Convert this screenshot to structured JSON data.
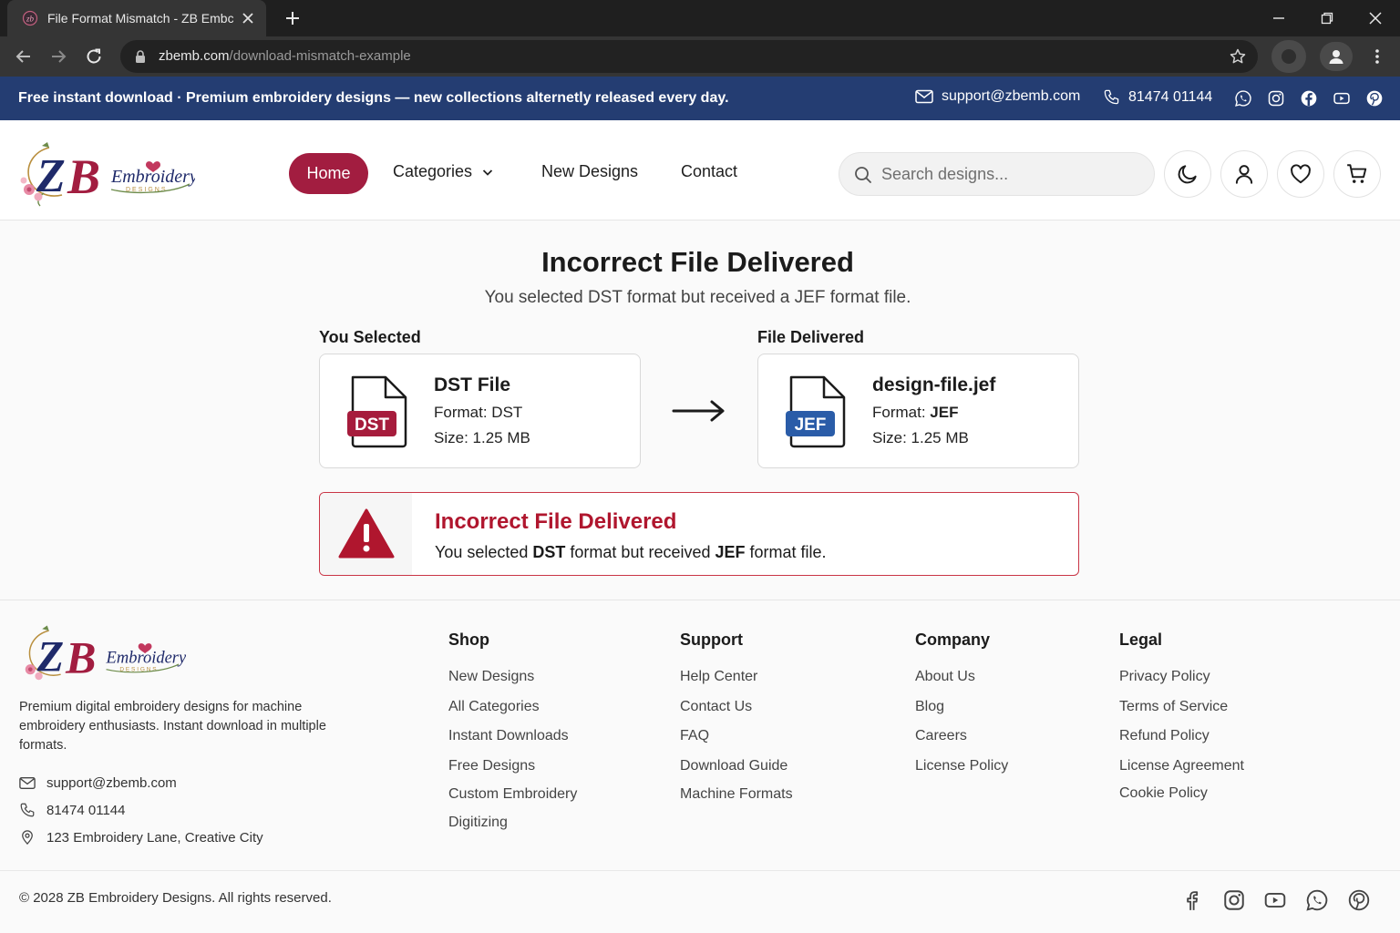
{
  "browser": {
    "tab_title": "File Format Mismatch - ZB Embc",
    "url_host": "zbemb.com",
    "url_path": "/download-mismatch-example"
  },
  "announcement": {
    "message": "Free instant download · Premium embroidery designs — new collections alternetly released every day.",
    "email": "support@zbemb.com",
    "phone": "81474 01144",
    "social_icons": [
      "whatsapp-icon",
      "instagram-icon",
      "facebook-icon",
      "youtube-icon",
      "pinterest-icon"
    ]
  },
  "header": {
    "nav": {
      "home": "Home",
      "categories": "Categories",
      "new_designs": "New Designs",
      "contact": "Contact"
    },
    "search_placeholder": "Search designs...",
    "icons": [
      "moon-icon",
      "user-icon",
      "heart-icon",
      "cart-icon"
    ]
  },
  "main": {
    "title": "Incorrect File Delivered",
    "subtitle": "You selected DST format but received a JEF format file.",
    "selected": {
      "label": "You Selected",
      "badge": "DST",
      "name": "DST File",
      "format_label": "Format: ",
      "format": "DST",
      "size": "Size: 1.25 MB"
    },
    "delivered": {
      "label": "File Delivered",
      "badge": "JEF",
      "name": "design-file.jef",
      "format_label": "Format: ",
      "format": "JEF",
      "size": "Size: 1.25 MB"
    },
    "error": {
      "title": "Incorrect File Delivered",
      "text_1": "You selected ",
      "format_1": "DST",
      "text_2": " format but received ",
      "format_2": "JEF",
      "text_3": " format file."
    }
  },
  "footer": {
    "description": "Premium digital embroidery designs for machine embroidery enthusiasts. Instant download in multiple formats.",
    "email": "support@zbemb.com",
    "phone": "81474 01144",
    "address": "123 Embroidery Lane, Creative City",
    "columns": [
      {
        "title": "Shop",
        "links": [
          "New Designs",
          "All Categories",
          "Instant Downloads",
          "Free Designs",
          "Custom Embroidery",
          "Digitizing"
        ]
      },
      {
        "title": "Support",
        "links": [
          "Help Center",
          "Contact Us",
          "FAQ",
          "Download Guide",
          "Machine Formats"
        ]
      },
      {
        "title": "Company",
        "links": [
          "About Us",
          "Blog",
          "Careers",
          "License Policy"
        ]
      },
      {
        "title": "Legal",
        "links": [
          "Privacy Policy",
          "Terms of Service",
          "Refund Policy",
          "License Agreement",
          "Cookie Policy"
        ]
      }
    ],
    "copyright": "© 2028 ZB Embroidery Designs. All rights reserved.",
    "social_icons": [
      "facebook-icon",
      "instagram-icon",
      "youtube-icon",
      "whatsapp-icon",
      "pinterest-icon"
    ]
  },
  "colors": {
    "brand": "#a21d40",
    "announcement_bg": "#243d72",
    "dst_badge": "#a61c3c",
    "jef_badge": "#2a5ca8",
    "error": "#b0162e"
  }
}
